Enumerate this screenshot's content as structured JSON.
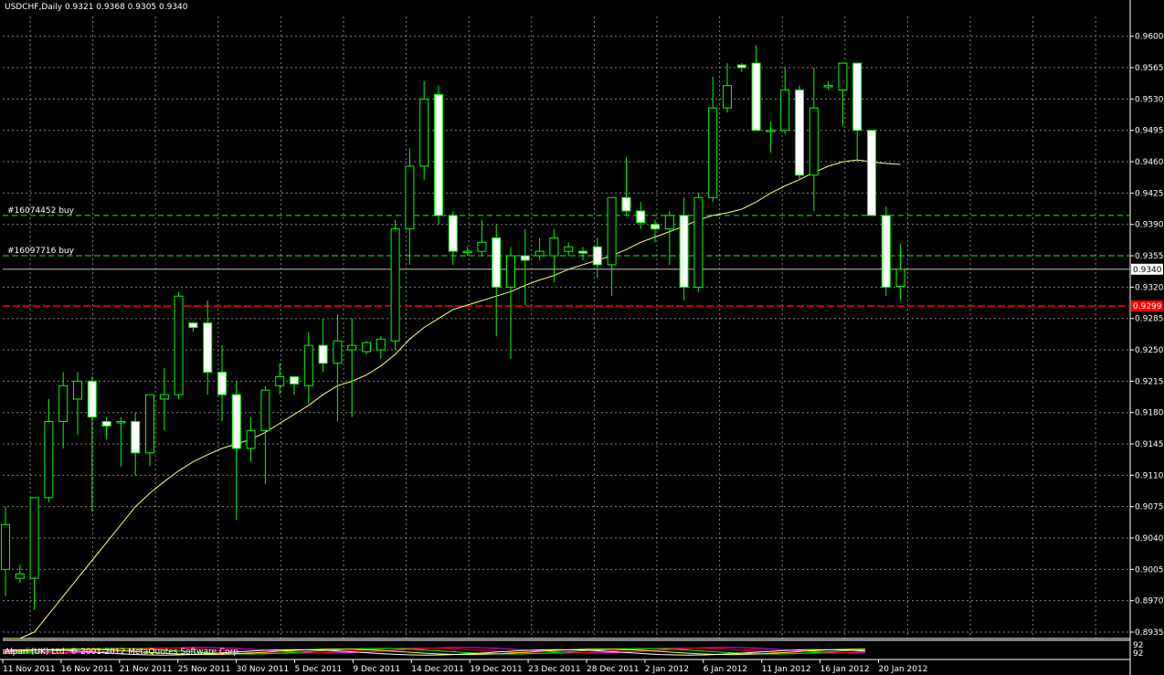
{
  "chart_header": "USDCHF,Daily  0.9321 0.9368 0.9305 0.9340",
  "bottom_overlay_text": "Alpari (UK) Ltd. © 2001-2012 MetaQuotes Software Corp.",
  "bottom_panel_labels": [
    "92",
    "92"
  ],
  "colors": {
    "background": "#000000",
    "bull_outline": "#00ff00",
    "bear_fill": "#ffffff",
    "wick": "#00ff00",
    "grid": "#808080",
    "moving_average": "#ffff80",
    "order_line": "#00ff00",
    "bid_line": "#c0c0c0",
    "stop_line": "#ff0000"
  },
  "chart_data": {
    "type": "candlestick",
    "symbol": "USDCHF",
    "timeframe": "Daily",
    "last_ohlc": {
      "open": 0.9321,
      "high": 0.9368,
      "low": 0.9305,
      "close": 0.934
    },
    "ylim": [
      0.892,
      0.962
    ],
    "y_ticks": [
      "0.9600",
      "0.9565",
      "0.9530",
      "0.9495",
      "0.9460",
      "0.9425",
      "0.9390",
      "0.9355",
      "0.9320",
      "0.9285",
      "0.9250",
      "0.9215",
      "0.9180",
      "0.9145",
      "0.9110",
      "0.9075",
      "0.9040",
      "0.9005",
      "0.8970",
      "0.8935"
    ],
    "x_labels": [
      "11 Nov 2011",
      "16 Nov 2011",
      "21 Nov 2011",
      "25 Nov 2011",
      "30 Nov 2011",
      "5 Dec 2011",
      "9 Dec 2011",
      "14 Dec 2011",
      "19 Dec 2011",
      "23 Dec 2011",
      "28 Dec 2011",
      "2 Jan 2012",
      "6 Jan 2012",
      "11 Jan 2012",
      "16 Jan 2012",
      "20 Jan 2012"
    ],
    "current_price": {
      "label": "0.9340",
      "value": 0.934
    },
    "stop_level": {
      "label": "0.9299",
      "value": 0.9299
    },
    "order_lines": [
      {
        "label": "#16074452 buy",
        "value": 0.94
      },
      {
        "label": "#16097716 buy",
        "value": 0.9355
      }
    ],
    "candles": [
      {
        "o": 0.9005,
        "h": 0.9075,
        "l": 0.8975,
        "c": 0.9055
      },
      {
        "o": 0.8995,
        "h": 0.901,
        "l": 0.899,
        "c": 0.9
      },
      {
        "o": 0.8995,
        "h": 0.9085,
        "l": 0.896,
        "c": 0.9085
      },
      {
        "o": 0.9085,
        "h": 0.9195,
        "l": 0.908,
        "c": 0.917
      },
      {
        "o": 0.917,
        "h": 0.9225,
        "l": 0.914,
        "c": 0.921
      },
      {
        "o": 0.9195,
        "h": 0.9225,
        "l": 0.9155,
        "c": 0.9215
      },
      {
        "o": 0.9215,
        "h": 0.922,
        "l": 0.907,
        "c": 0.9175
      },
      {
        "o": 0.917,
        "h": 0.9175,
        "l": 0.915,
        "c": 0.9165
      },
      {
        "o": 0.917,
        "h": 0.9175,
        "l": 0.912,
        "c": 0.917
      },
      {
        "o": 0.917,
        "h": 0.918,
        "l": 0.911,
        "c": 0.9135
      },
      {
        "o": 0.9135,
        "h": 0.92,
        "l": 0.912,
        "c": 0.92
      },
      {
        "o": 0.9195,
        "h": 0.923,
        "l": 0.916,
        "c": 0.92
      },
      {
        "o": 0.92,
        "h": 0.9315,
        "l": 0.9195,
        "c": 0.931
      },
      {
        "o": 0.928,
        "h": 0.928,
        "l": 0.927,
        "c": 0.9275
      },
      {
        "o": 0.928,
        "h": 0.9305,
        "l": 0.92,
        "c": 0.9225
      },
      {
        "o": 0.9225,
        "h": 0.9255,
        "l": 0.917,
        "c": 0.92
      },
      {
        "o": 0.92,
        "h": 0.9215,
        "l": 0.906,
        "c": 0.914
      },
      {
        "o": 0.914,
        "h": 0.9175,
        "l": 0.9125,
        "c": 0.916
      },
      {
        "o": 0.916,
        "h": 0.921,
        "l": 0.91,
        "c": 0.9205
      },
      {
        "o": 0.921,
        "h": 0.9235,
        "l": 0.92,
        "c": 0.922
      },
      {
        "o": 0.922,
        "h": 0.922,
        "l": 0.92,
        "c": 0.9212
      },
      {
        "o": 0.921,
        "h": 0.927,
        "l": 0.919,
        "c": 0.9255
      },
      {
        "o": 0.9255,
        "h": 0.9285,
        "l": 0.9225,
        "c": 0.9235
      },
      {
        "o": 0.9235,
        "h": 0.929,
        "l": 0.917,
        "c": 0.926
      },
      {
        "o": 0.925,
        "h": 0.9285,
        "l": 0.9175,
        "c": 0.9255
      },
      {
        "o": 0.9248,
        "h": 0.926,
        "l": 0.9245,
        "c": 0.9258
      },
      {
        "o": 0.925,
        "h": 0.9265,
        "l": 0.924,
        "c": 0.9262
      },
      {
        "o": 0.926,
        "h": 0.9395,
        "l": 0.925,
        "c": 0.9385
      },
      {
        "o": 0.9385,
        "h": 0.9475,
        "l": 0.9345,
        "c": 0.9455
      },
      {
        "o": 0.9455,
        "h": 0.955,
        "l": 0.944,
        "c": 0.953
      },
      {
        "o": 0.9535,
        "h": 0.9545,
        "l": 0.939,
        "c": 0.94
      },
      {
        "o": 0.94,
        "h": 0.9405,
        "l": 0.9345,
        "c": 0.936
      },
      {
        "o": 0.936,
        "h": 0.9365,
        "l": 0.9355,
        "c": 0.936
      },
      {
        "o": 0.936,
        "h": 0.9395,
        "l": 0.9355,
        "c": 0.937
      },
      {
        "o": 0.9375,
        "h": 0.939,
        "l": 0.9265,
        "c": 0.932
      },
      {
        "o": 0.932,
        "h": 0.9365,
        "l": 0.924,
        "c": 0.9355
      },
      {
        "o": 0.9355,
        "h": 0.9385,
        "l": 0.93,
        "c": 0.935
      },
      {
        "o": 0.9355,
        "h": 0.9375,
        "l": 0.935,
        "c": 0.936
      },
      {
        "o": 0.9355,
        "h": 0.9385,
        "l": 0.9325,
        "c": 0.9375
      },
      {
        "o": 0.936,
        "h": 0.937,
        "l": 0.9355,
        "c": 0.9365
      },
      {
        "o": 0.936,
        "h": 0.9365,
        "l": 0.935,
        "c": 0.9358
      },
      {
        "o": 0.9365,
        "h": 0.9375,
        "l": 0.933,
        "c": 0.9345
      },
      {
        "o": 0.9345,
        "h": 0.942,
        "l": 0.931,
        "c": 0.942
      },
      {
        "o": 0.942,
        "h": 0.9465,
        "l": 0.94,
        "c": 0.9405
      },
      {
        "o": 0.9405,
        "h": 0.9415,
        "l": 0.9385,
        "c": 0.9392
      },
      {
        "o": 0.939,
        "h": 0.9395,
        "l": 0.937,
        "c": 0.9385
      },
      {
        "o": 0.9385,
        "h": 0.9405,
        "l": 0.9345,
        "c": 0.94
      },
      {
        "o": 0.94,
        "h": 0.942,
        "l": 0.9305,
        "c": 0.932
      },
      {
        "o": 0.932,
        "h": 0.9425,
        "l": 0.9315,
        "c": 0.942
      },
      {
        "o": 0.942,
        "h": 0.9555,
        "l": 0.9415,
        "c": 0.952
      },
      {
        "o": 0.952,
        "h": 0.957,
        "l": 0.9515,
        "c": 0.9545
      },
      {
        "o": 0.9568,
        "h": 0.957,
        "l": 0.956,
        "c": 0.9565
      },
      {
        "o": 0.957,
        "h": 0.959,
        "l": 0.9495,
        "c": 0.9495
      },
      {
        "o": 0.9495,
        "h": 0.9505,
        "l": 0.947,
        "c": 0.9495
      },
      {
        "o": 0.9495,
        "h": 0.9565,
        "l": 0.949,
        "c": 0.954
      },
      {
        "o": 0.954,
        "h": 0.9545,
        "l": 0.944,
        "c": 0.9445
      },
      {
        "o": 0.9445,
        "h": 0.9565,
        "l": 0.9405,
        "c": 0.952
      },
      {
        "o": 0.9545,
        "h": 0.955,
        "l": 0.954,
        "c": 0.9545
      },
      {
        "o": 0.954,
        "h": 0.957,
        "l": 0.95,
        "c": 0.957
      },
      {
        "o": 0.957,
        "h": 0.957,
        "l": 0.946,
        "c": 0.9495
      },
      {
        "o": 0.9495,
        "h": 0.9495,
        "l": 0.94,
        "c": 0.94
      },
      {
        "o": 0.94,
        "h": 0.941,
        "l": 0.931,
        "c": 0.932
      },
      {
        "o": 0.9321,
        "h": 0.9368,
        "l": 0.9305,
        "c": 0.934
      }
    ],
    "moving_average": [
      0.892,
      0.8925,
      0.8935,
      0.8955,
      0.8975,
      0.8995,
      0.9015,
      0.9035,
      0.9055,
      0.9075,
      0.909,
      0.9103,
      0.9115,
      0.9125,
      0.9133,
      0.914,
      0.9145,
      0.915,
      0.9158,
      0.9168,
      0.9178,
      0.9188,
      0.92,
      0.921,
      0.9215,
      0.9222,
      0.9232,
      0.9245,
      0.9262,
      0.9275,
      0.9285,
      0.9295,
      0.93,
      0.9305,
      0.931,
      0.9315,
      0.9322,
      0.9328,
      0.9333,
      0.934,
      0.9345,
      0.935,
      0.9355,
      0.9362,
      0.937,
      0.9376,
      0.9382,
      0.9388,
      0.9395,
      0.94,
      0.9403,
      0.9407,
      0.9415,
      0.9425,
      0.9433,
      0.944,
      0.9448,
      0.9455,
      0.946,
      0.9462,
      0.946,
      0.9458,
      0.9457
    ]
  }
}
